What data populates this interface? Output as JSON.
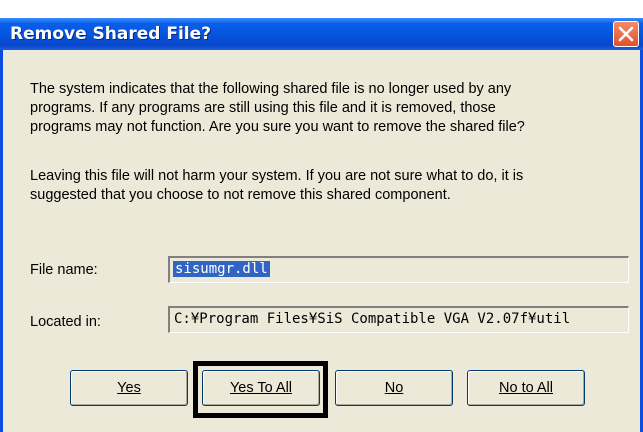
{
  "dialog": {
    "title": "Remove Shared File?",
    "close_icon": "close-icon",
    "message1": "The system indicates that the following shared file is no longer used by any\nprograms.  If any programs are still using this file and it is removed, those\nprograms may not function.  Are you sure you want to remove the shared file?",
    "message2": "Leaving this file will not harm your system.  If you are not sure what to do, it is\nsuggested that you choose to not remove this shared component."
  },
  "fields": {
    "file_name_label": "File name:",
    "file_name_value": "sisumgr.dll",
    "located_in_label": "Located in:",
    "located_in_value": "C:¥Program Files¥SiS Compatible VGA V2.07f¥util"
  },
  "buttons": {
    "yes": "Yes",
    "yes_to_all": "Yes To All",
    "no": "No",
    "no_to_all": "No to All"
  },
  "colors": {
    "titlebar": "#0553dd",
    "close_button": "#e2502b",
    "dialog_bg": "#ece9d8",
    "selection": "#3165c4"
  }
}
